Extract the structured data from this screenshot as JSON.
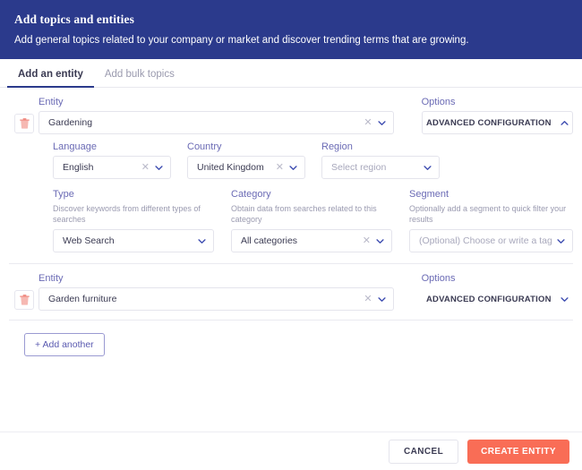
{
  "header": {
    "title": "Add topics and entities",
    "subtitle": "Add general topics related to your company or market and discover trending terms that are growing."
  },
  "tabs": [
    {
      "label": "Add an entity",
      "active": true
    },
    {
      "label": "Add bulk topics",
      "active": false
    }
  ],
  "entities": [
    {
      "entity_label": "Entity",
      "entity_value": "Gardening",
      "options_label": "Options",
      "options_button": "ADVANCED CONFIGURATION",
      "expanded": true,
      "language": {
        "label": "Language",
        "value": "English"
      },
      "country": {
        "label": "Country",
        "value": "United Kingdom"
      },
      "region": {
        "label": "Region",
        "placeholder": "Select region",
        "value": ""
      },
      "type": {
        "label": "Type",
        "helper": "Discover keywords from different types of searches",
        "value": "Web Search"
      },
      "category": {
        "label": "Category",
        "helper": "Obtain data from searches related to this category",
        "value": "All categories"
      },
      "segment": {
        "label": "Segment",
        "helper": "Optionally add a segment to quick filter your results",
        "placeholder": "(Optional) Choose or write a tag",
        "value": ""
      }
    },
    {
      "entity_label": "Entity",
      "entity_value": "Garden furniture",
      "options_label": "Options",
      "options_button": "ADVANCED CONFIGURATION",
      "expanded": false
    }
  ],
  "add_another_label": "+ Add another",
  "footer": {
    "cancel_label": "CANCEL",
    "create_label": "CREATE ENTITY"
  },
  "colors": {
    "header_bg": "#2b3a8c",
    "label": "#6b6bb5",
    "primary_button": "#f96d56",
    "trash": "#f2a6a0"
  }
}
